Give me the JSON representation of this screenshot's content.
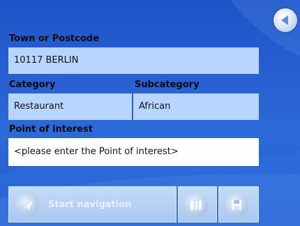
{
  "form": {
    "town_label": "Town or Postcode",
    "town_value": "10117 BERLIN",
    "category_label": "Category",
    "category_value": "Restaurant",
    "subcategory_label": "Subcategory",
    "subcategory_value": "African",
    "poi_label": "Point of interest",
    "poi_placeholder": "<please enter the Point of interest>"
  },
  "actions": {
    "start_navigation_label": "Start navigation",
    "start_navigation_enabled": false,
    "map_button_enabled": false,
    "save_button_enabled": false
  },
  "icons": {
    "back": "back-arrow-icon",
    "start_navigation": "navigation-arrow-icon",
    "map": "map-icon",
    "save": "floppy-disk-icon"
  },
  "colors": {
    "background": "#2a63d4",
    "field": "#b7d5ff",
    "input_active": "#ffffff",
    "disabled_button": "#b4d0f4"
  }
}
